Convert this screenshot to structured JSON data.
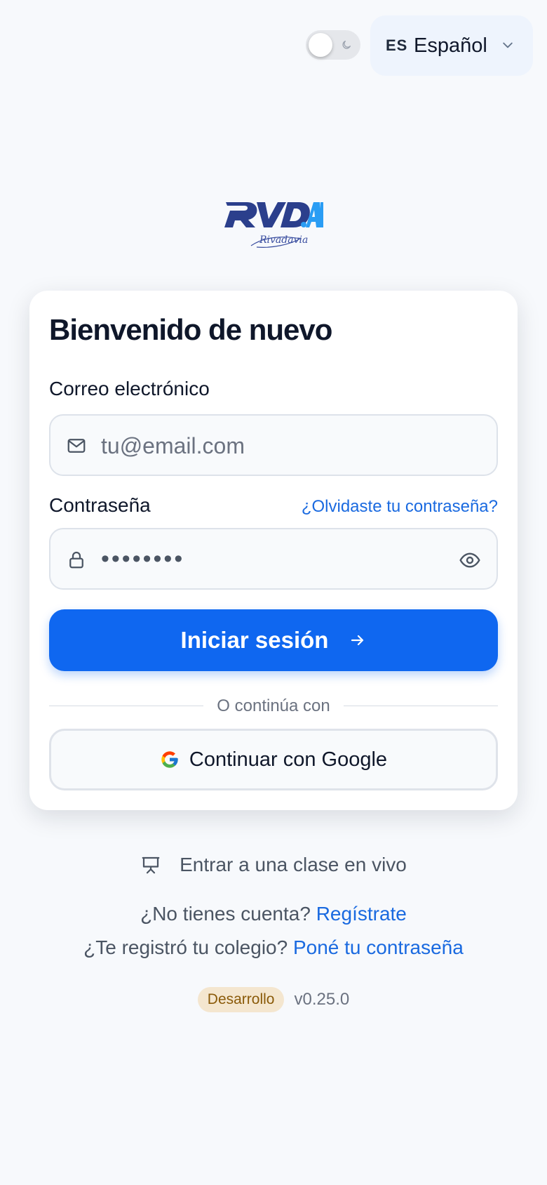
{
  "header": {
    "theme_toggle": {
      "state": "light",
      "icon": "moon-icon"
    },
    "language": {
      "code": "ES",
      "label": "Español"
    }
  },
  "brand": {
    "logo_text": "RVD.AI",
    "logo_subtext": "Rivadavia",
    "colors": {
      "primary": "#2b3f8c",
      "accent": "#2a9df4"
    }
  },
  "login": {
    "title": "Bienvenido de nuevo",
    "email": {
      "label": "Correo electrónico",
      "placeholder": "tu@email.com",
      "value": ""
    },
    "password": {
      "label": "Contraseña",
      "masked_value": "••••••••",
      "forgot_link": "¿Olvidaste tu contraseña?"
    },
    "submit_label": "Iniciar sesión",
    "divider_text": "O continúa con",
    "google_label": "Continuar con Google"
  },
  "secondary": {
    "live_class_label": "Entrar a una clase en vivo",
    "signup_prompt": "¿No tienes cuenta?",
    "signup_link": "Regístrate",
    "school_prompt": "¿Te registró tu colegio?",
    "school_link": "Poné tu contraseña"
  },
  "footer": {
    "env_badge": "Desarrollo",
    "version": "v0.25.0"
  },
  "colors": {
    "primary_button": "#0f67f0",
    "link": "#1a6ae0",
    "background": "#f7f9fc",
    "badge_bg": "#f4e6cf",
    "badge_text": "#8a5a09"
  }
}
